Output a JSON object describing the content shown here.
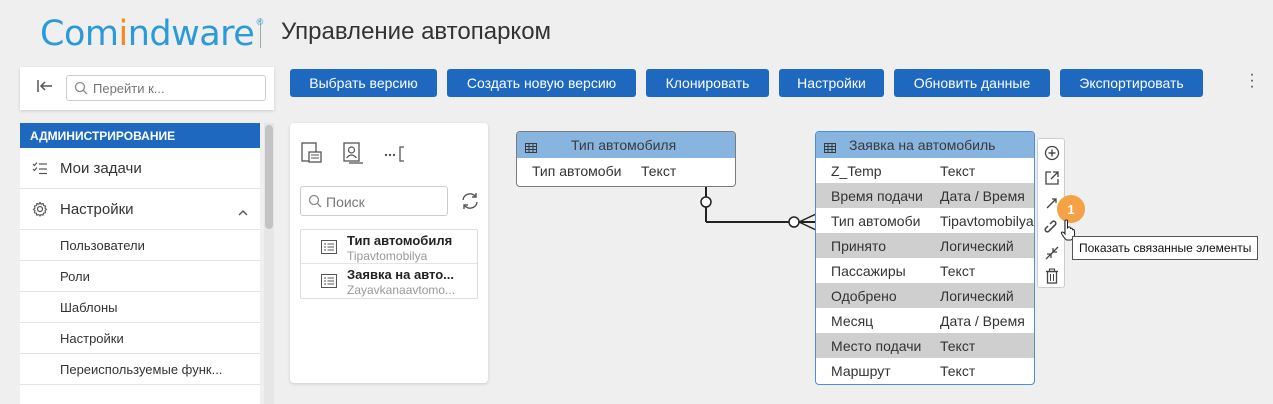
{
  "header": {
    "logo_part1": "Com",
    "logo_part2": "i",
    "logo_part3": "ndware",
    "logo_reg": "®",
    "app_title": "Управление автопарком"
  },
  "sidebar": {
    "search_placeholder": "Перейти к...",
    "section_title": "АДМИНИСТРИРОВАНИЕ",
    "items": [
      {
        "label": "Мои задачи",
        "icon": "task-list-icon"
      },
      {
        "label": "Настройки",
        "icon": "gear-icon",
        "expanded": true
      }
    ],
    "subitems": [
      "Пользователи",
      "Роли",
      "Шаблоны",
      "Настройки",
      "Переиспользуемые функ..."
    ]
  },
  "toolbar": {
    "buttons": [
      "Выбрать версию",
      "Создать новую версию",
      "Клонировать",
      "Настройки",
      "Обновить данные",
      "Экспортировать"
    ]
  },
  "left_panel": {
    "search_placeholder": "Поиск",
    "items": [
      {
        "title": "Тип автомобиля",
        "subtitle": "Tipavtomobilya"
      },
      {
        "title": "Заявка на авто...",
        "subtitle": "Zayavkanaavtomo..."
      }
    ]
  },
  "diagram": {
    "entity1": {
      "title": "Тип автомобиля",
      "rows": [
        {
          "name": "Тип автомоби",
          "type": "Текст"
        }
      ]
    },
    "entity2": {
      "title": "Заявка на автомобиль",
      "rows": [
        {
          "name": "Z_Temp",
          "type": "Текст"
        },
        {
          "name": "Время подачи",
          "type": "Дата / Время"
        },
        {
          "name": "Тип автомоби",
          "type": "Tipavtomobilya"
        },
        {
          "name": "Принято",
          "type": "Логический"
        },
        {
          "name": "Пассажиры",
          "type": "Текст"
        },
        {
          "name": "Одобрено",
          "type": "Логический"
        },
        {
          "name": "Месяц",
          "type": "Дата / Время"
        },
        {
          "name": "Место подачи",
          "type": "Текст"
        },
        {
          "name": "Маршрут",
          "type": "Текст"
        }
      ]
    },
    "badge": "1",
    "tooltip": "Показать связанные элементы"
  },
  "colors": {
    "primary": "#1e68c0",
    "entity_header": "#88b5df",
    "badge": "#f5a247",
    "logo_blue": "#2b9bd8",
    "logo_orange": "#f08d1e"
  }
}
